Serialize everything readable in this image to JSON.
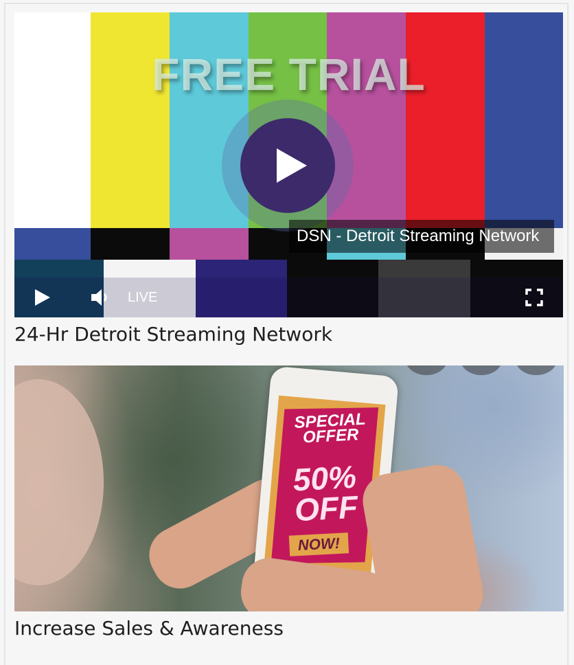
{
  "video": {
    "overlay_text": "FREE TRIAL",
    "caption": "DSN - Detroit Streaming Network",
    "live_label": "LIVE",
    "colors": {
      "top_bars": [
        "#ffffff",
        "#efe632",
        "#5ec9d9",
        "#76c045",
        "#b7519d",
        "#ea1f2a",
        "#364e9b"
      ],
      "mid_bars": [
        "#364e9b",
        "#0b0b0b",
        "#b7519d",
        "#0b0b0b",
        "#5ec9d9",
        "#0b0b0b",
        "#f2f2f2"
      ],
      "bot_bars": [
        "#123f5a",
        "#f4f4f4",
        "#2b2477",
        "#0b0b0b",
        "#3a3a3a",
        "#0b0b0b"
      ],
      "play_button": "#3c2a6b"
    },
    "icons": {
      "play": "play-icon",
      "volume": "volume-icon",
      "fullscreen": "fullscreen-icon",
      "big_play": "big-play-icon"
    }
  },
  "cards": [
    {
      "title": "24-Hr Detroit Streaming Network"
    },
    {
      "title": "Increase Sales & Awareness"
    }
  ],
  "promo": {
    "offer_line1": "SPECIAL",
    "offer_line2": "OFFER",
    "offer_percent": "50%",
    "offer_off": "OFF",
    "offer_now": "NOW!",
    "colors": {
      "offer_bg": "#c2185b",
      "offer_frame": "#e3a54a"
    }
  }
}
